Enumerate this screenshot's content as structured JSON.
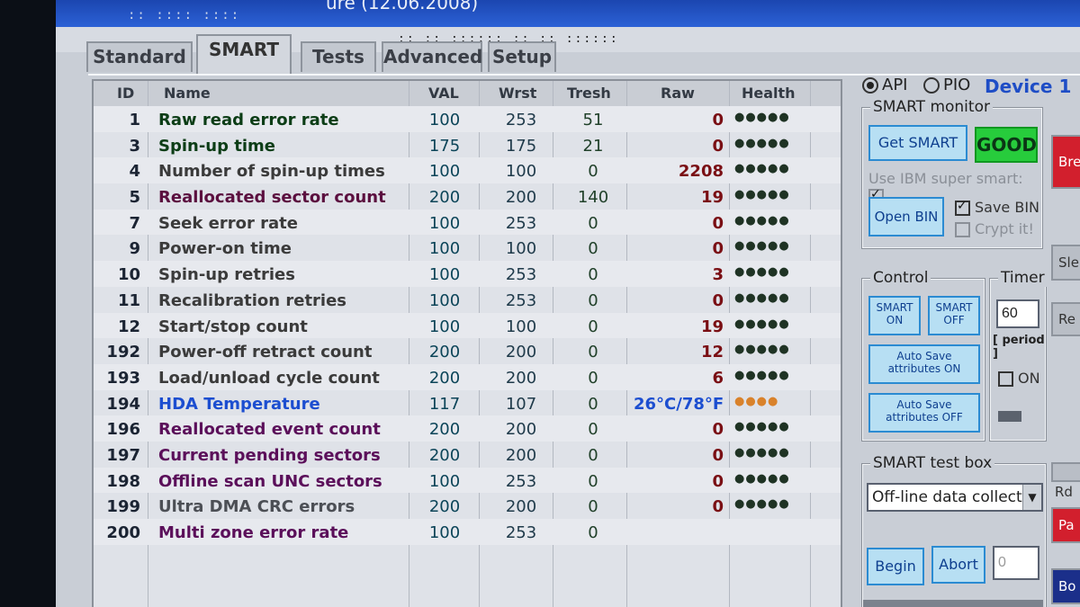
{
  "window": {
    "title": "ure (12.06.2008)"
  },
  "tabs": [
    {
      "label": "Standard"
    },
    {
      "label": "SMART"
    },
    {
      "label": "Tests"
    },
    {
      "label": "Advanced"
    },
    {
      "label": "Setup"
    }
  ],
  "columns": [
    "ID",
    "Name",
    "VAL",
    "Wrst",
    "Tresh",
    "Raw",
    "Health"
  ],
  "rows": [
    {
      "id": "1",
      "name": "Raw read error rate",
      "val": "100",
      "wrst": "253",
      "tresh": "51",
      "raw": "0",
      "health": "●●●●●",
      "name_color": "#0c3d16"
    },
    {
      "id": "3",
      "name": "Spin-up time",
      "val": "175",
      "wrst": "175",
      "tresh": "21",
      "raw": "0",
      "health": "●●●●●",
      "name_color": "#0c3d16"
    },
    {
      "id": "4",
      "name": "Number of spin-up times",
      "val": "100",
      "wrst": "100",
      "tresh": "0",
      "raw": "2208",
      "health": "●●●●●",
      "name_color": "#3b3b3b"
    },
    {
      "id": "5",
      "name": "Reallocated sector count",
      "val": "200",
      "wrst": "200",
      "tresh": "140",
      "raw": "19",
      "health": "●●●●●",
      "name_color": "#5b0f3f"
    },
    {
      "id": "7",
      "name": "Seek error rate",
      "val": "100",
      "wrst": "253",
      "tresh": "0",
      "raw": "0",
      "health": "●●●●●",
      "name_color": "#3b3b3b"
    },
    {
      "id": "9",
      "name": "Power-on time",
      "val": "100",
      "wrst": "100",
      "tresh": "0",
      "raw": "0",
      "health": "●●●●●",
      "name_color": "#3b3b3b"
    },
    {
      "id": "10",
      "name": "Spin-up retries",
      "val": "100",
      "wrst": "253",
      "tresh": "0",
      "raw": "3",
      "health": "●●●●●",
      "name_color": "#3b3b3b"
    },
    {
      "id": "11",
      "name": "Recalibration retries",
      "val": "100",
      "wrst": "253",
      "tresh": "0",
      "raw": "0",
      "health": "●●●●●",
      "name_color": "#3b3b3b"
    },
    {
      "id": "12",
      "name": "Start/stop count",
      "val": "100",
      "wrst": "100",
      "tresh": "0",
      "raw": "19",
      "health": "●●●●●",
      "name_color": "#3b3b3b"
    },
    {
      "id": "192",
      "name": "Power-off retract count",
      "val": "200",
      "wrst": "200",
      "tresh": "0",
      "raw": "12",
      "health": "●●●●●",
      "name_color": "#3b3b3b"
    },
    {
      "id": "193",
      "name": "Load/unload cycle count",
      "val": "200",
      "wrst": "200",
      "tresh": "0",
      "raw": "6",
      "health": "●●●●●",
      "name_color": "#3b3b3b"
    },
    {
      "id": "194",
      "name": "HDA Temperature",
      "val": "117",
      "wrst": "107",
      "tresh": "0",
      "raw": "26°C/78°F",
      "health": "●●●●",
      "name_color": "#1c4ed0"
    },
    {
      "id": "196",
      "name": "Reallocated event count",
      "val": "200",
      "wrst": "200",
      "tresh": "0",
      "raw": "0",
      "health": "●●●●●",
      "name_color": "#5b0f5a"
    },
    {
      "id": "197",
      "name": "Current pending sectors",
      "val": "200",
      "wrst": "200",
      "tresh": "0",
      "raw": "0",
      "health": "●●●●●",
      "name_color": "#5b0f5a"
    },
    {
      "id": "198",
      "name": "Offline scan UNC sectors",
      "val": "100",
      "wrst": "253",
      "tresh": "0",
      "raw": "0",
      "health": "●●●●●",
      "name_color": "#5b0f5a"
    },
    {
      "id": "199",
      "name": "Ultra DMA CRC errors",
      "val": "200",
      "wrst": "200",
      "tresh": "0",
      "raw": "0",
      "health": "●●●●●",
      "name_color": "#4c4f55"
    },
    {
      "id": "200",
      "name": "Multi zone error rate",
      "val": "100",
      "wrst": "253",
      "tresh": "0",
      "raw": "",
      "health": "",
      "name_color": "#5b0f5a"
    }
  ],
  "side": {
    "api_label": "API",
    "pio_label": "PIO",
    "device_label": "Device 1",
    "smart_monitor_label": "SMART monitor",
    "get_smart_label": "Get SMART",
    "good_label": "GOOD",
    "ibm_label": "Use IBM super smart:",
    "open_bin_label": "Open BIN",
    "save_bin_label": "Save BIN",
    "crypt_label": "Crypt it!",
    "control_label": "Control",
    "smart_on_label": "SMART ON",
    "smart_off_label": "SMART OFF",
    "autosave_on_label": "Auto Save attributes ON",
    "autosave_off_label": "Auto Save attributes OFF",
    "timer_label": "Timer",
    "timer_value": "60",
    "period_label": "[ period ]",
    "on_label": "ON",
    "test_box_label": "SMART test box",
    "test_select_value": "Off-line data collect",
    "begin_label": "Begin",
    "abort_label": "Abort",
    "abort_value": "0"
  },
  "rightbar": {
    "btn1": "Brea",
    "btn2": "Sle",
    "btn3": "Re",
    "rd_label": "Rd",
    "btn4": "Pa",
    "btn5": "Bo"
  },
  "colors": {
    "raw_red": "#7a0f14",
    "temp_blue": "#1c4ed0",
    "health_green": "#1f3324",
    "health_orange": "#d9822b"
  }
}
